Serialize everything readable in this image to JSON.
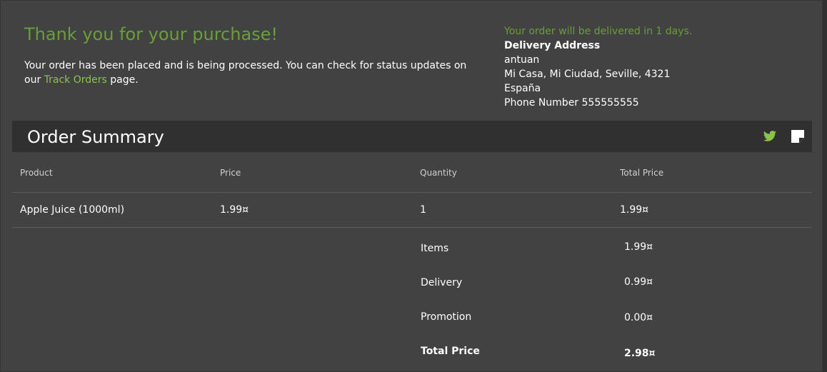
{
  "confirmation": {
    "title": "Thank you for your purchase!",
    "message_before_link": "Your order has been placed and is being processed. You can check for status updates on our ",
    "link_text": "Track Orders",
    "message_after_link": " page."
  },
  "delivery": {
    "eta": "Your order will be delivered in 1 days.",
    "address_label": "Delivery Address",
    "name": "antuan",
    "address_line": "Mi Casa, Mi Ciudad, Seville, 4321",
    "country": "España",
    "phone": "Phone Number 555555555"
  },
  "summary": {
    "title": "Order Summary",
    "icons": [
      "twitter-icon",
      "note-icon"
    ],
    "columns": [
      "Product",
      "Price",
      "Quantity",
      "Total Price"
    ],
    "items": [
      {
        "product": "Apple Juice (1000ml)",
        "price": "1.99¤",
        "quantity": "1",
        "total": "1.99¤"
      }
    ],
    "totals": [
      {
        "label": "Items",
        "value": "1.99¤"
      },
      {
        "label": "Delivery",
        "value": "0.99¤"
      },
      {
        "label": "Promotion",
        "value": "0.00¤"
      },
      {
        "label": "Total Price",
        "value": "2.98¤"
      }
    ]
  },
  "colors": {
    "background": "#303030",
    "card": "#424242",
    "accent": "#689f38",
    "link": "#8bc34a"
  }
}
